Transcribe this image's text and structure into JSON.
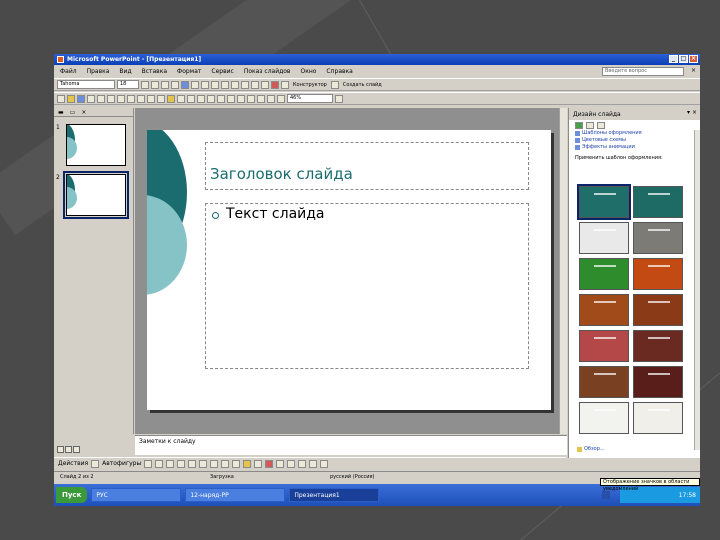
{
  "window": {
    "title": "Microsoft PowerPoint - [Презентация1]"
  },
  "menu": {
    "items": [
      "Файл",
      "Правка",
      "Вид",
      "Вставка",
      "Формат",
      "Сервис",
      "Показ слайдов",
      "Окно",
      "Справка"
    ],
    "help_placeholder": "Введите вопрос"
  },
  "toolbar": {
    "font_name": "Tahoma",
    "font_size": "18",
    "constructor_label": "Конструктор",
    "new_slide_label": "Создать слайд",
    "zoom": "46%"
  },
  "slides_panel": {
    "thumbs": [
      {
        "num": "1"
      },
      {
        "num": "2"
      }
    ]
  },
  "slide": {
    "title": "Заголовок слайда",
    "body": "Текст слайда"
  },
  "notes": {
    "placeholder": "Заметки к слайду"
  },
  "draw_toolbar": {
    "actions_label": "Действия",
    "autoshapes_label": "Автофигуры"
  },
  "status": {
    "slide": "Слайд 2 из 2",
    "design": "Загрузка",
    "language": "русский (Россия)"
  },
  "task_pane": {
    "title": "Дизайн слайда",
    "links": [
      "Шаблоны оформления",
      "Цветовые схемы",
      "Эффекты анимации"
    ],
    "caption": "Применить шаблон оформления:",
    "browse_label": "Обзор...",
    "templates": [
      {
        "color": "#1f6e6a",
        "selected": true
      },
      {
        "color": "#1e6b66",
        "selected": false
      },
      {
        "color": "#e9e9e9",
        "selected": false
      },
      {
        "color": "#7d7b76",
        "selected": false
      },
      {
        "color": "#2f8c2c",
        "selected": false
      },
      {
        "color": "#c34a12",
        "selected": false
      },
      {
        "color": "#a14b1b",
        "selected": false
      },
      {
        "color": "#8a3a16",
        "selected": false
      },
      {
        "color": "#b44848",
        "selected": false
      },
      {
        "color": "#6a2a22",
        "selected": false
      },
      {
        "color": "#7a4022",
        "selected": false
      },
      {
        "color": "#5a1e1a",
        "selected": false
      },
      {
        "color": "#f2f2ee",
        "selected": false
      },
      {
        "color": "#f0efe9",
        "selected": false
      }
    ]
  },
  "taskbar": {
    "start_label": "Пуск",
    "items": [
      "РУС",
      "12-наряд-PP",
      "Презентация1"
    ],
    "clock": "17:58",
    "tooltip": "Отображение значков в области уведомлений"
  }
}
